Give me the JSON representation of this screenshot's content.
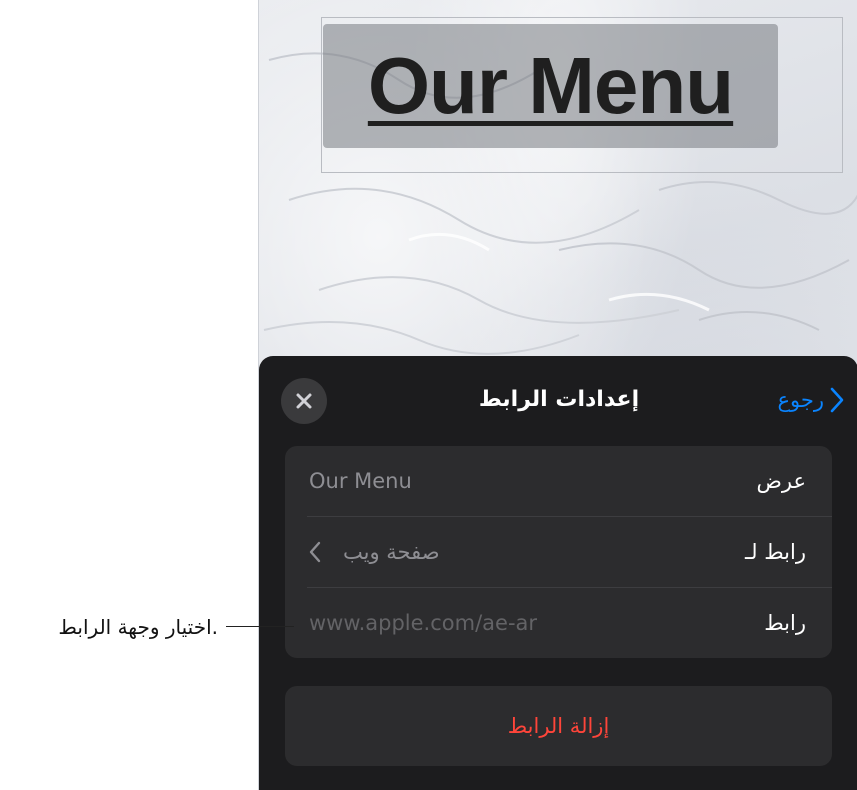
{
  "slide": {
    "title": "Our Menu"
  },
  "sheet": {
    "title": "إعدادات الرابط",
    "back_label": "رجوع",
    "close_icon": "close-icon",
    "back_icon": "chevron-right-icon",
    "rows": [
      {
        "label": "عرض",
        "value": "Our Menu"
      },
      {
        "label": "رابط لـ",
        "value": "صفحة ويب",
        "icon": "chevron-left-icon"
      },
      {
        "label": "رابط",
        "value": "www.apple.com/ae-ar"
      }
    ],
    "remove_label": "إزالة الرابط"
  },
  "callout": {
    "text": "اختيار وجهة الرابط."
  },
  "colors": {
    "sheet_bg": "#1c1c1e",
    "card_bg": "#2c2c2e",
    "accent": "#0a84ff",
    "destructive": "#ff453a"
  }
}
